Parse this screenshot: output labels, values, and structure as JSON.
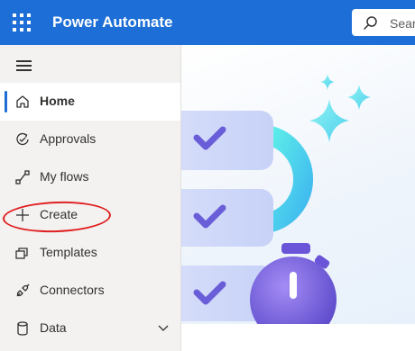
{
  "app": {
    "title": "Power Automate"
  },
  "search": {
    "placeholder": "Sear"
  },
  "nav": {
    "items": [
      {
        "label": "Home",
        "icon": "home-icon",
        "active": true
      },
      {
        "label": "Approvals",
        "icon": "approvals-icon"
      },
      {
        "label": "My flows",
        "icon": "flows-icon"
      },
      {
        "label": "Create",
        "icon": "plus-icon"
      },
      {
        "label": "Templates",
        "icon": "templates-icon"
      },
      {
        "label": "Connectors",
        "icon": "connectors-icon"
      },
      {
        "label": "Data",
        "icon": "database-icon",
        "expandable": true
      }
    ]
  },
  "colors": {
    "accent": "#1d6ed6",
    "highlight": "#e02020"
  }
}
